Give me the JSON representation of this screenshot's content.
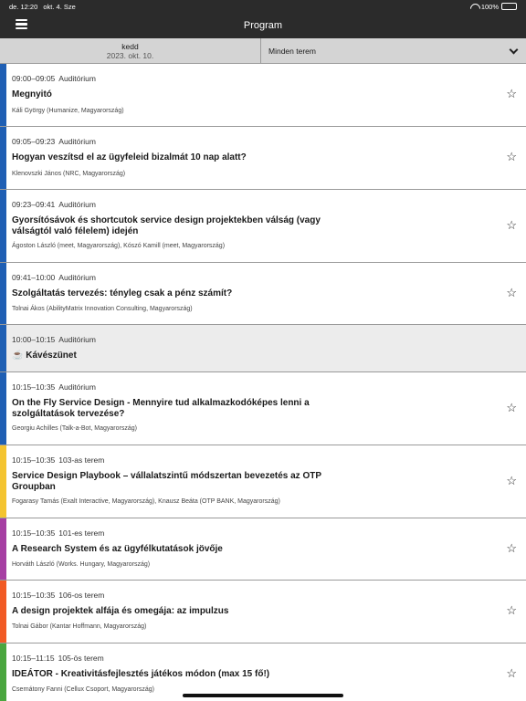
{
  "status_bar": {
    "time": "de. 12:20",
    "date": "okt. 4. Sze",
    "battery": "100%"
  },
  "nav": {
    "title": "Program"
  },
  "filters": {
    "day": "kedd",
    "date": "2023. okt. 10.",
    "room": "Minden terem"
  },
  "colors": {
    "blue": "#1f5fb4",
    "yellow": "#f4c430",
    "purple": "#a63fa3",
    "orange": "#f15a24",
    "green": "#4aa63f"
  },
  "sessions": [
    {
      "time": "09:00–09:05",
      "room": "Auditórium",
      "title": "Megnyitó",
      "speakers": "Káli György (Humanize, Magyarország)"
    },
    {
      "time": "09:05–09:23",
      "room": "Auditórium",
      "title": "Hogyan veszítsd el az ügyfeleid bizalmát 10 nap alatt?",
      "speakers": "Klenovszki János (NRC, Magyarország)"
    },
    {
      "time": "09:23–09:41",
      "room": "Auditórium",
      "title": "Gyorsítósávok és shortcutok service design projektekben válság (vagy válságtól való félelem) idején",
      "speakers": "Ágoston László (meet, Magyarország), Kószó Kamill (meet, Magyarország)"
    },
    {
      "time": "09:41–10:00",
      "room": "Auditórium",
      "title": "Szolgáltatás tervezés: tényleg csak a pénz számít?",
      "speakers": "Tolnai Ákos (AbilityMatrix Innovation Consulting, Magyarország)"
    },
    {
      "time": "10:00–10:15",
      "room": "Auditórium",
      "title": "☕ Kávészünet",
      "speakers": ""
    },
    {
      "time": "10:15–10:35",
      "room": "Auditórium",
      "title": "On the Fly Service Design - Mennyire tud alkalmazkodóképes lenni a szolgáltatások tervezése?",
      "speakers": "Georgiu Achilles (Talk-a-Bot, Magyarország)"
    },
    {
      "time": "10:15–10:35",
      "room": "103-as terem",
      "title": "Service Design Playbook – vállalatszintű módszertan bevezetés az OTP Groupban",
      "speakers": "Fogarasy Tamás (Exalt Interactive, Magyarország), Knausz Beáta (OTP BANK, Magyarország)"
    },
    {
      "time": "10:15–10:35",
      "room": "101-es terem",
      "title": "A Research System és az ügyfélkutatások jövője",
      "speakers": "Horváth László (Works. Hungary, Magyarország)"
    },
    {
      "time": "10:15–10:35",
      "room": "106-os terem",
      "title": " A design projektek alfája és omegája: az impulzus",
      "speakers": "Tolnai Gábor (Kantar Hoffmann, Magyarország)"
    },
    {
      "time": "10:15–11:15",
      "room": "105-ös terem",
      "title": "IDEÁTOR - Kreativitásfejlesztés játékos módon (max 15 fő!)",
      "speakers": "Csernátony Fanni (Cellux Csoport, Magyarország)"
    }
  ]
}
